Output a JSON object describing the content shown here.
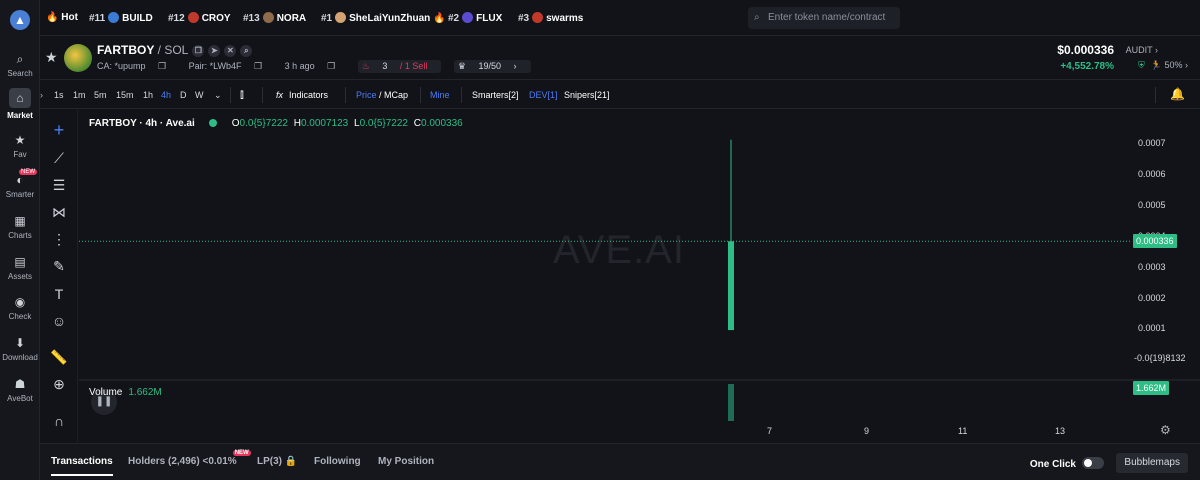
{
  "sidebar": {
    "items": [
      {
        "label": "Search",
        "icon": "search-icon"
      },
      {
        "label": "Market",
        "icon": "market-icon",
        "active": true
      },
      {
        "label": "Fav",
        "icon": "star-icon"
      },
      {
        "label": "Smarter",
        "icon": "smarter-icon",
        "badge": "NEW"
      },
      {
        "label": "Charts",
        "icon": "charts-icon"
      },
      {
        "label": "Assets",
        "icon": "assets-icon"
      },
      {
        "label": "Check",
        "icon": "check-icon"
      },
      {
        "label": "Download",
        "icon": "download-icon"
      },
      {
        "label": "AveBot",
        "icon": "avebot-icon"
      }
    ]
  },
  "topbar": {
    "hot_label": "Hot",
    "trending": [
      {
        "rank": "#11",
        "name": "BUILD",
        "color": "#3a7bd5"
      },
      {
        "rank": "#12",
        "name": "CROY",
        "color": "#c0392b"
      },
      {
        "rank": "#13",
        "name": "NORA",
        "color": "#8e6b4a"
      },
      {
        "rank": "#1",
        "name": "SheLaiYunZhuan",
        "color": "#d4a373"
      },
      {
        "rank": "#2",
        "name": "FLUX",
        "color": "#5b4bd1"
      },
      {
        "rank": "#3",
        "name": "swarms",
        "color": "#c0392b"
      }
    ],
    "search_placeholder": "Enter token name/contract"
  },
  "token": {
    "name": "FARTBOY",
    "chain": " / SOL",
    "ca": "CA: *upump",
    "pair": "Pair: *LWb4F",
    "age": "3 h ago",
    "buy_sell_count": "3",
    "sell_label": " / 1 Sell",
    "holders_ratio": "19/50",
    "price": "$0.000336",
    "change": "+4,552.78%",
    "audit_label": "AUDIT",
    "audit_score": "50%"
  },
  "chart_toolbar": {
    "timeframes": [
      "1s",
      "1m",
      "5m",
      "15m",
      "1h",
      "4h",
      "D",
      "W"
    ],
    "active_timeframe": "4h",
    "indicators_label": "Indicators",
    "price_label": "Price",
    "mcap_label": " / MCap",
    "mine_label": "Mine",
    "smarters_label": "Smarters[2]",
    "dev_label": "DEV[1]",
    "snipers_label": "Snipers[21]"
  },
  "chart_data": {
    "type": "candlestick",
    "title": "FARTBOY · 4h · Ave.ai",
    "watermark": "AVE.AI",
    "ohlc": {
      "o_label": "O",
      "o": "0.0{5}7222",
      "h_label": "H",
      "h": "0.0007123",
      "l_label": "L",
      "l": "0.0{5}7222",
      "c_label": "C",
      "c": "0.000336"
    },
    "candles": [
      {
        "open": 7.2e-06,
        "high": 0.0007123,
        "low": 7.2e-06,
        "close": 0.000336
      }
    ],
    "ylim": [
      0,
      0.0007123
    ],
    "y_ticks": [
      "0.0007",
      "0.0006",
      "0.0005",
      "0.0004",
      "0.0003",
      "0.0002",
      "0.0001",
      "-0.0{19}8132"
    ],
    "current_price_label": "0.000336",
    "x_ticks": [
      "7",
      "9",
      "11",
      "13"
    ],
    "volume_label": "Volume",
    "volume_value": "1.662M",
    "volume_box": "1.662M",
    "up_color": "#2ebd85"
  },
  "bottom_tabs": {
    "tabs": [
      "Transactions",
      "Holders (2,496)",
      "LP(3)",
      "Following",
      "My Position"
    ],
    "holders_pct": "<0.01%",
    "holders_badge": "NEW",
    "one_click_label": "One Click",
    "bubblemaps_label": "Bubblemaps"
  }
}
